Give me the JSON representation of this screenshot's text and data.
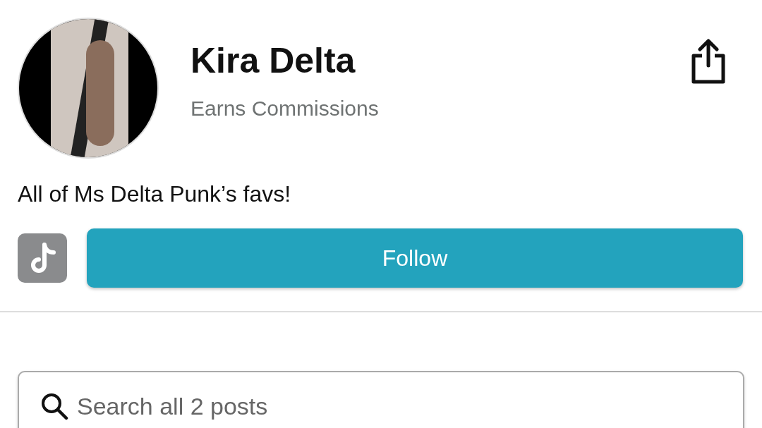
{
  "profile": {
    "name": "Kira Delta",
    "subtitle": "Earns Commissions",
    "bio": "All of Ms Delta Punk’s favs!"
  },
  "follow_button": {
    "label": "Follow"
  },
  "search": {
    "placeholder": "Search all 2 posts"
  }
}
